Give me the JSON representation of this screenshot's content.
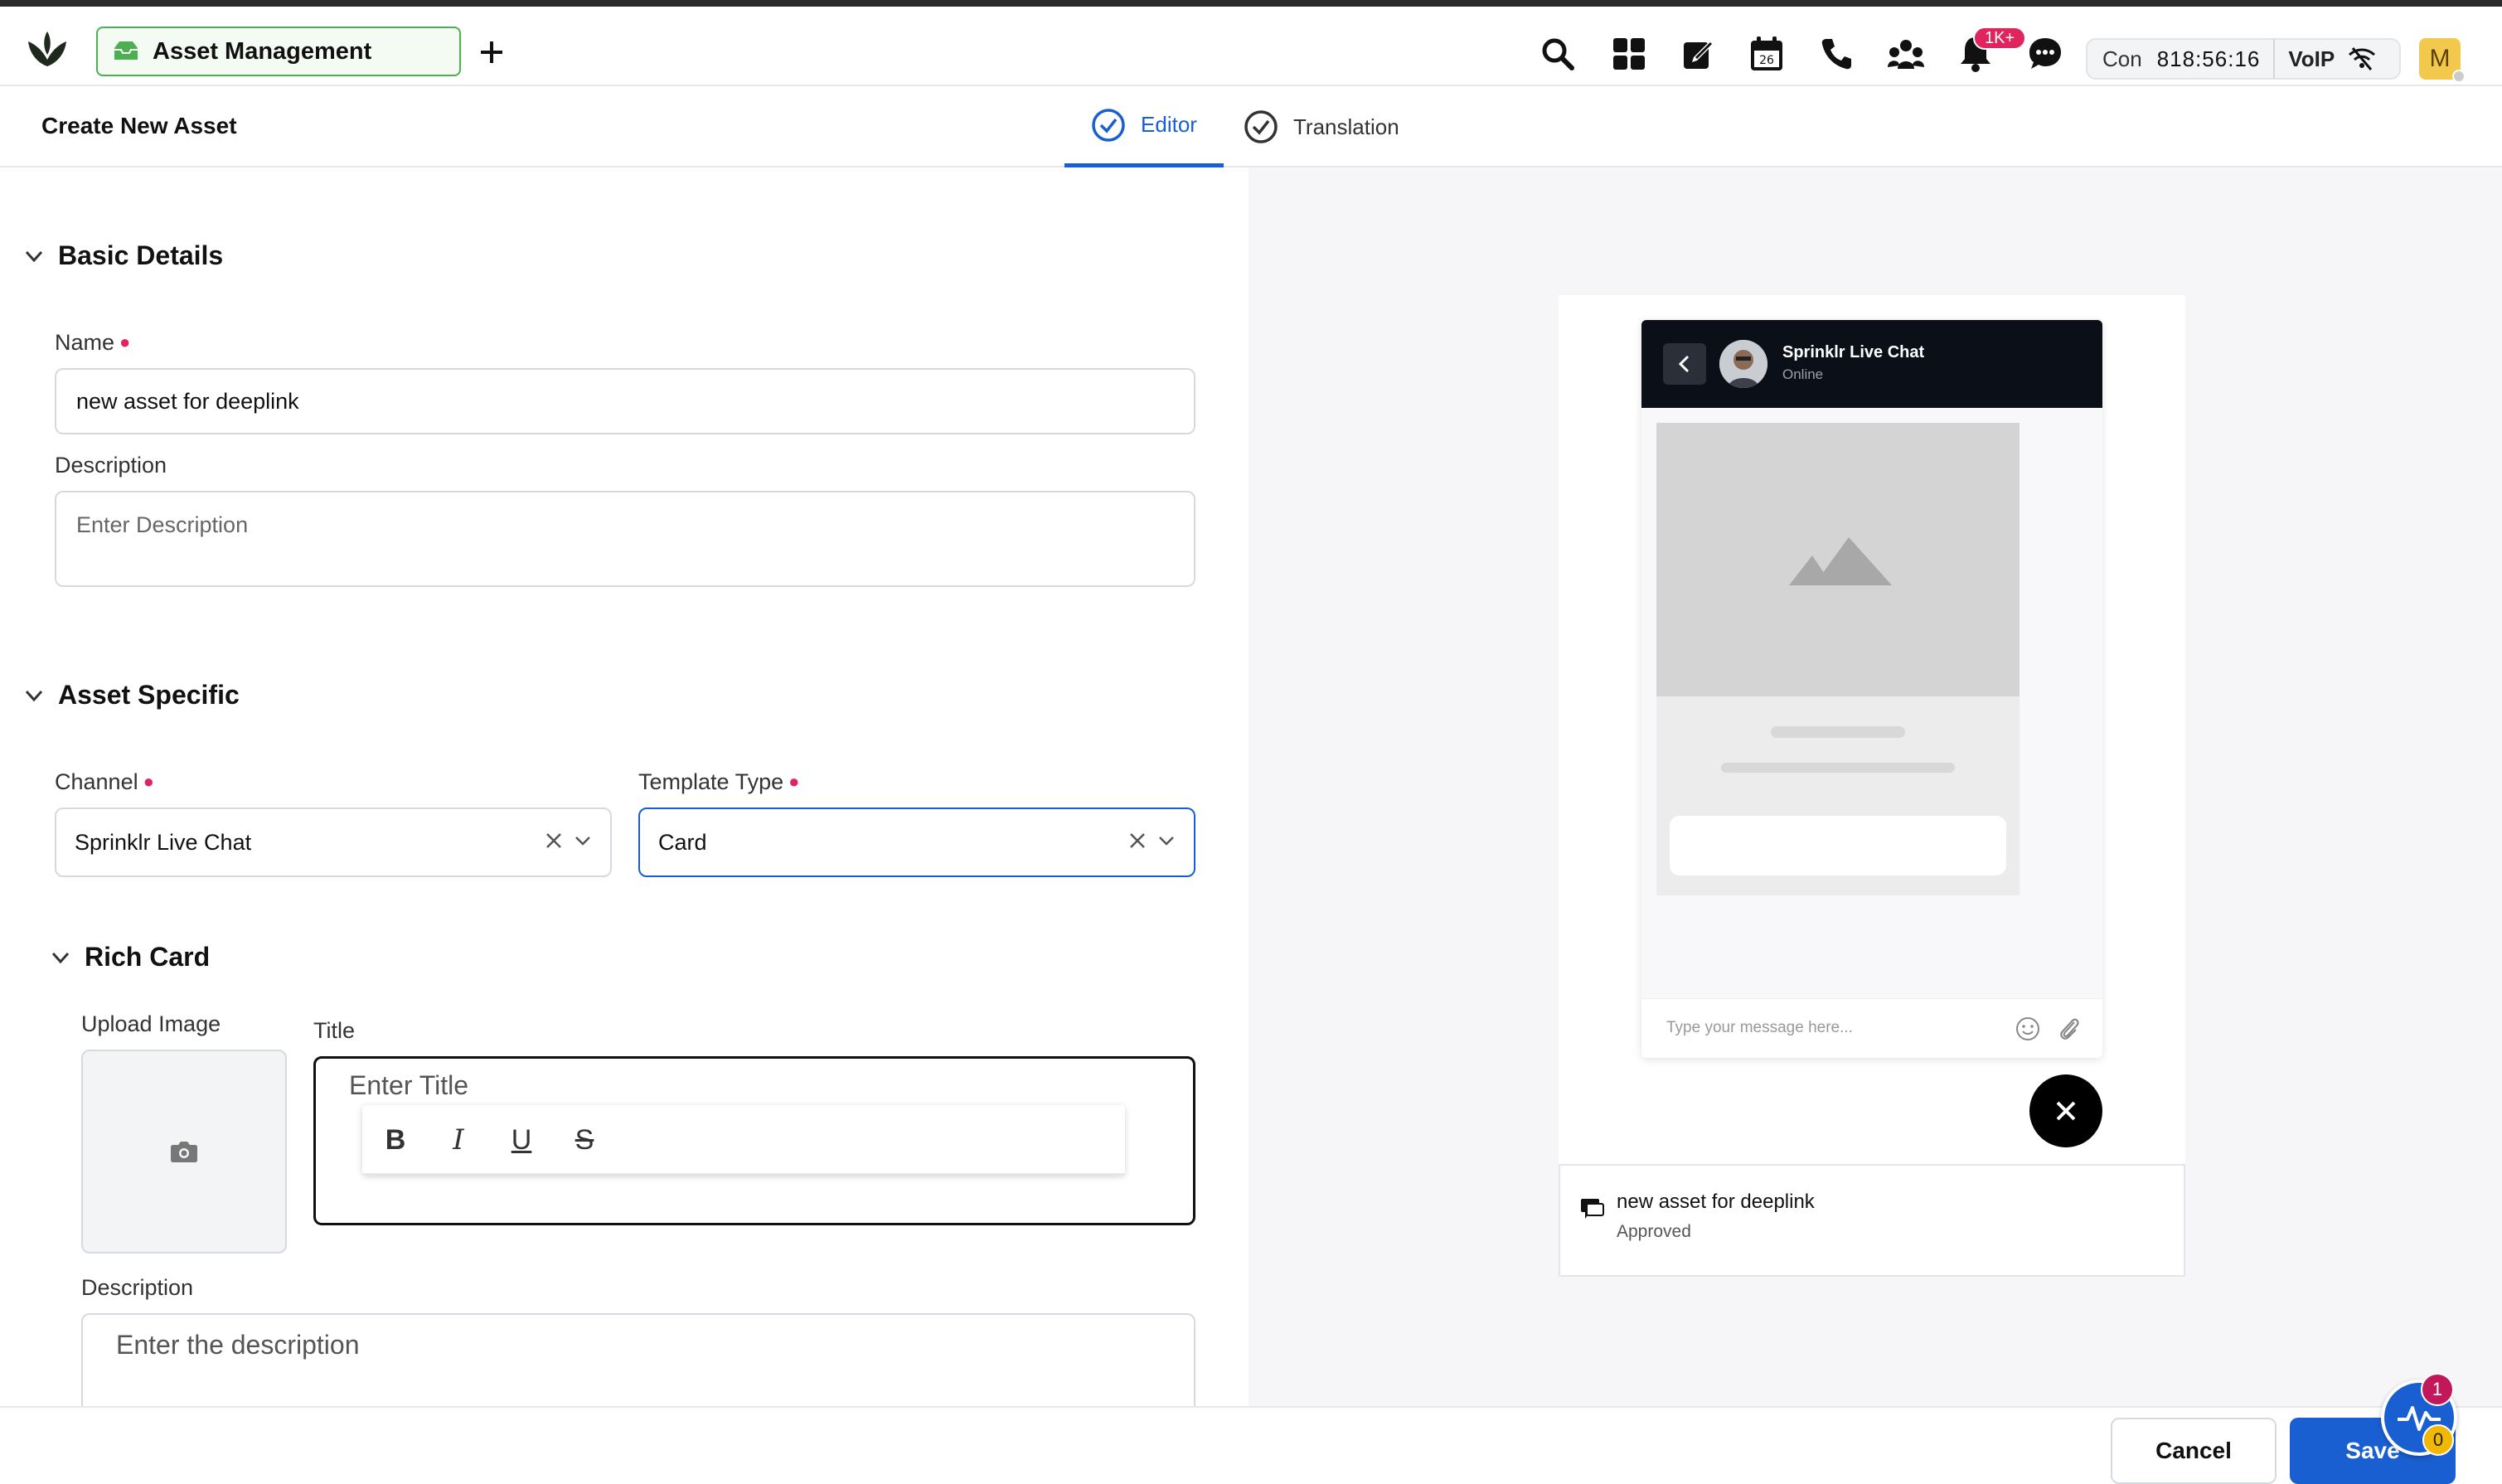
{
  "app": {
    "tab_label": "Asset Management",
    "notifications_badge": "1K+",
    "calendar_day": "26",
    "status": {
      "con_label": "Con",
      "timer": "818:56:16",
      "voip_label": "VoIP"
    },
    "user_initial": "M"
  },
  "header": {
    "page_title": "Create New Asset",
    "tabs": [
      {
        "label": "Editor",
        "active": true
      },
      {
        "label": "Translation",
        "active": false
      }
    ]
  },
  "form": {
    "basic_details": {
      "heading": "Basic Details",
      "name_label": "Name",
      "name_value": "new asset for deeplink",
      "description_label": "Description",
      "description_placeholder": "Enter Description"
    },
    "asset_specific": {
      "heading": "Asset Specific",
      "channel_label": "Channel",
      "channel_value": "Sprinklr Live Chat",
      "template_type_label": "Template Type",
      "template_type_value": "Card"
    },
    "rich_card": {
      "heading": "Rich Card",
      "upload_image_label": "Upload Image",
      "title_label": "Title",
      "title_placeholder": "Enter Title",
      "toolbar": {
        "bold": "B",
        "italic": "I",
        "underline": "U",
        "strike": "S"
      },
      "description_label": "Description",
      "description_placeholder": "Enter the description"
    }
  },
  "preview": {
    "chat_name": "Sprinklr Live Chat",
    "chat_status": "Online",
    "message_placeholder": "Type your message here...",
    "asset_name": "new asset for deeplink",
    "asset_status": "Approved"
  },
  "footer": {
    "cancel_label": "Cancel",
    "save_label": "Save",
    "helper_badge_alert": "1",
    "helper_badge_count": "0"
  },
  "colors": {
    "primary": "#1a5fd1",
    "required": "#e0245e",
    "app_tab_border": "#4caf50",
    "notif_badge": "#e0245e"
  }
}
